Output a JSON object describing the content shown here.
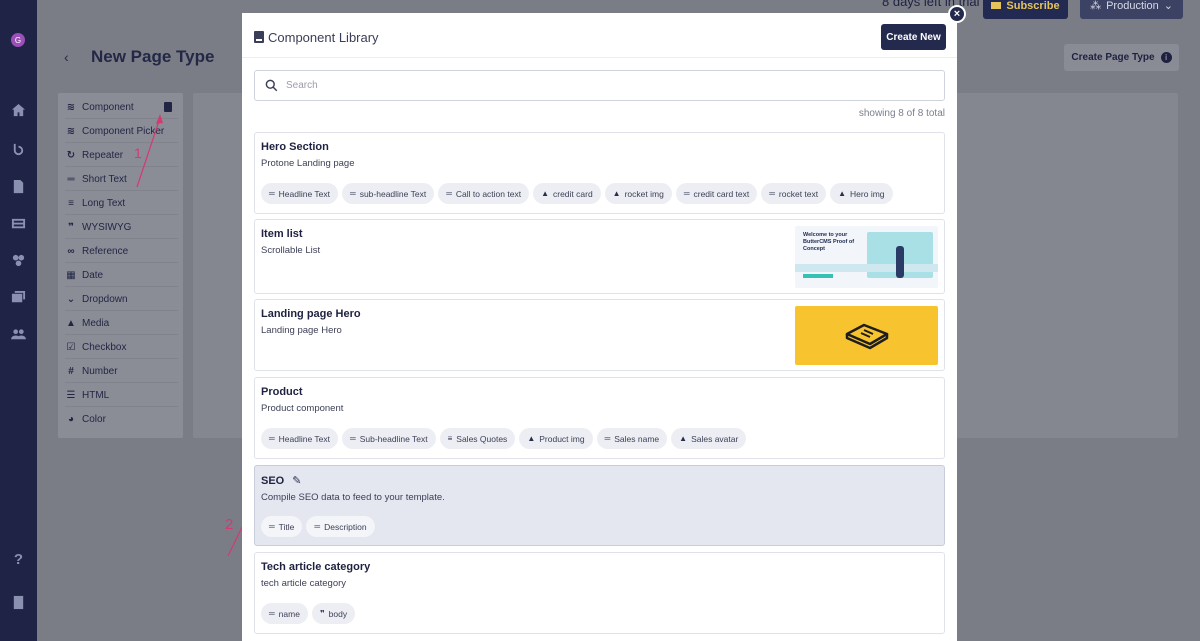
{
  "background": {
    "trial_text": "8 days left in trial",
    "subscribe_label": "Subscribe",
    "production_label": "Production",
    "page_title": "New Page Type",
    "create_page_type_label": "Create Page Type",
    "field_types": [
      {
        "label": "Component",
        "icon": "component-icon"
      },
      {
        "label": "Component Picker",
        "icon": "component-picker-icon"
      },
      {
        "label": "Repeater",
        "icon": "repeater-icon"
      },
      {
        "label": "Short Text",
        "icon": "short-text-icon"
      },
      {
        "label": "Long Text",
        "icon": "long-text-icon"
      },
      {
        "label": "WYSIWYG",
        "icon": "quote-icon"
      },
      {
        "label": "Reference",
        "icon": "link-icon"
      },
      {
        "label": "Date",
        "icon": "calendar-icon"
      },
      {
        "label": "Dropdown",
        "icon": "chevron-down-icon"
      },
      {
        "label": "Media",
        "icon": "image-icon"
      },
      {
        "label": "Checkbox",
        "icon": "checkbox-icon"
      },
      {
        "label": "Number",
        "icon": "hash-icon"
      },
      {
        "label": "HTML",
        "icon": "list-icon"
      },
      {
        "label": "Color",
        "icon": "palette-icon"
      }
    ],
    "annotations": [
      "1",
      "2"
    ]
  },
  "modal": {
    "title": "Component Library",
    "create_new_label": "Create New",
    "close_label": "×",
    "search_placeholder": "Search",
    "showing_text": "showing 8 of 8 total",
    "components": [
      {
        "name": "Hero Section",
        "description": "Protone Landing page",
        "fields": [
          {
            "label": "Headline Text",
            "icon": "text-icon"
          },
          {
            "label": "sub-headline Text",
            "icon": "text-icon"
          },
          {
            "label": "Call to action text",
            "icon": "text-icon"
          },
          {
            "label": "credit card",
            "icon": "image-icon"
          },
          {
            "label": "rocket img",
            "icon": "image-icon"
          },
          {
            "label": "credit card text",
            "icon": "text-icon"
          },
          {
            "label": "rocket text",
            "icon": "text-icon"
          },
          {
            "label": "Hero img",
            "icon": "image-icon"
          }
        ]
      },
      {
        "name": "Item list",
        "description": "Scrollable List",
        "thumbnail_text": "Welcome to your ButterCMS Proof of Concept",
        "fields": []
      },
      {
        "name": "Landing page Hero",
        "description": "Landing page Hero",
        "fields": []
      },
      {
        "name": "Product",
        "description": "Product component",
        "fields": [
          {
            "label": "Headline Text",
            "icon": "text-icon"
          },
          {
            "label": "Sub-headline Text",
            "icon": "text-icon"
          },
          {
            "label": "Sales Quotes",
            "icon": "long-text-icon"
          },
          {
            "label": "Product img",
            "icon": "image-icon"
          },
          {
            "label": "Sales name",
            "icon": "text-icon"
          },
          {
            "label": "Sales avatar",
            "icon": "image-icon"
          }
        ]
      },
      {
        "name": "SEO",
        "description": "Compile SEO data to feed to your template.",
        "fields": [
          {
            "label": "Title",
            "icon": "text-icon"
          },
          {
            "label": "Description",
            "icon": "text-icon"
          }
        ]
      },
      {
        "name": "Tech article category",
        "description": "tech article category",
        "fields": [
          {
            "label": "name",
            "icon": "text-icon"
          },
          {
            "label": "body",
            "icon": "quote-icon"
          }
        ]
      }
    ]
  },
  "colors": {
    "accent_navy": "#232a4d",
    "annotation_pink": "#d23a70",
    "thumbnail_yellow": "#f7c42f",
    "highlight_card": "#e4e6f0"
  }
}
